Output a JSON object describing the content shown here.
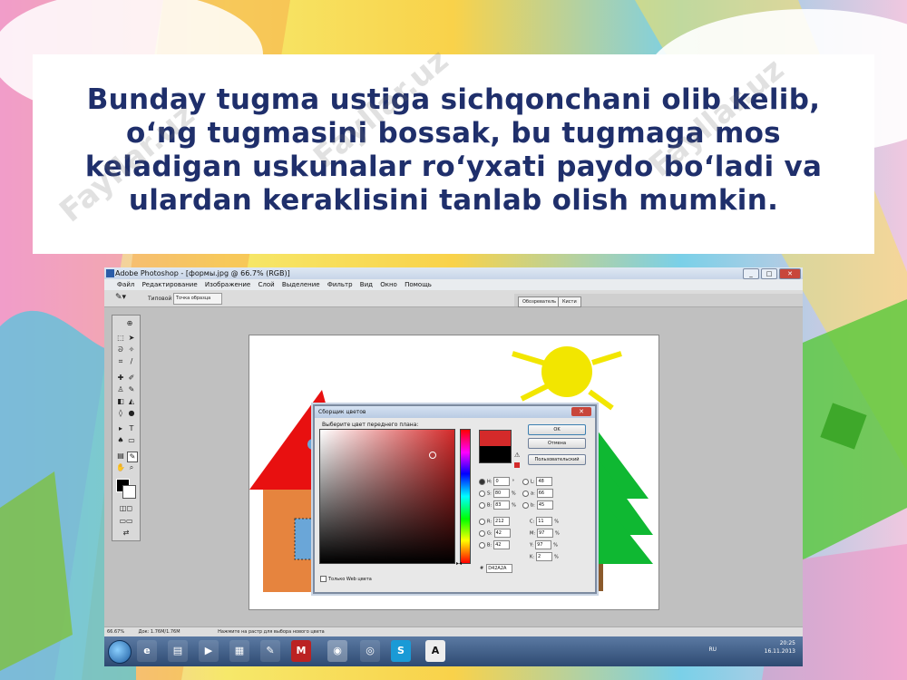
{
  "slide": {
    "caption_lines": [
      "Bunday tugma ustiga sichqonchani olib kelib,",
      "o‘ng tugmasini bossak, bu tugmaga mos",
      "keladigan uskunalar ro‘yxati paydo bo‘ladi va",
      "ulardan keraklisini tanlab olish mumkin."
    ],
    "watermark": "Fayllar.uz",
    "colors": {
      "caption": "#1f2f6b"
    }
  },
  "photoshop": {
    "title": "Adobe Photoshop - [формы.jpg @ 66.7% (RGB)]",
    "menu": [
      "Файл",
      "Редактирование",
      "Изображение",
      "Слой",
      "Выделение",
      "Фильтр",
      "Вид",
      "Окно",
      "Помощь"
    ],
    "options": {
      "sample_label": "Типовой размер:",
      "sample_value": "Точка образца"
    },
    "palette_tabs": [
      "Обозреватель",
      "Кисти"
    ],
    "status": {
      "zoom": "66.67%",
      "doc": "Док: 1.76M/1.76M",
      "hint": "Нажмите на растр для выбора нового цвета"
    }
  },
  "color_picker": {
    "title": "Сборщик цветов",
    "prompt": "Выберите цвет переднего плана:",
    "buttons": {
      "ok": "OK",
      "cancel": "Отмена",
      "custom": "Пользовательский"
    },
    "fields": [
      {
        "label": "H:",
        "value": "0",
        "unit": "°"
      },
      {
        "label": "S:",
        "value": "80",
        "unit": "%"
      },
      {
        "label": "B:",
        "value": "83",
        "unit": "%"
      },
      {
        "label": "R:",
        "value": "212",
        "unit": ""
      },
      {
        "label": "G:",
        "value": "42",
        "unit": ""
      },
      {
        "label": "B:",
        "value": "42",
        "unit": ""
      }
    ],
    "lab_fields": [
      {
        "label": "L:",
        "value": "48",
        "unit": ""
      },
      {
        "label": "a:",
        "value": "66",
        "unit": ""
      },
      {
        "label": "b:",
        "value": "45",
        "unit": ""
      }
    ],
    "cmyk_fields": [
      {
        "label": "C:",
        "value": "11",
        "unit": "%"
      },
      {
        "label": "M:",
        "value": "97",
        "unit": "%"
      },
      {
        "label": "Y:",
        "value": "97",
        "unit": "%"
      },
      {
        "label": "K:",
        "value": "2",
        "unit": "%"
      }
    ],
    "hex_label": "#",
    "hex": "D42A2A",
    "web_only": "Только Web цвета",
    "new_color": "#d42a2a",
    "old_color": "#000000"
  },
  "taskbar": {
    "lang": "RU",
    "time": "20:25",
    "date": "16.11.2013",
    "apps": [
      "ie-icon",
      "folder-icon",
      "media-icon",
      "apps-icon",
      "paint-icon",
      "antivirus-icon",
      "photoshop-icon",
      "chrome-icon",
      "skype-icon",
      "font-icon"
    ]
  }
}
